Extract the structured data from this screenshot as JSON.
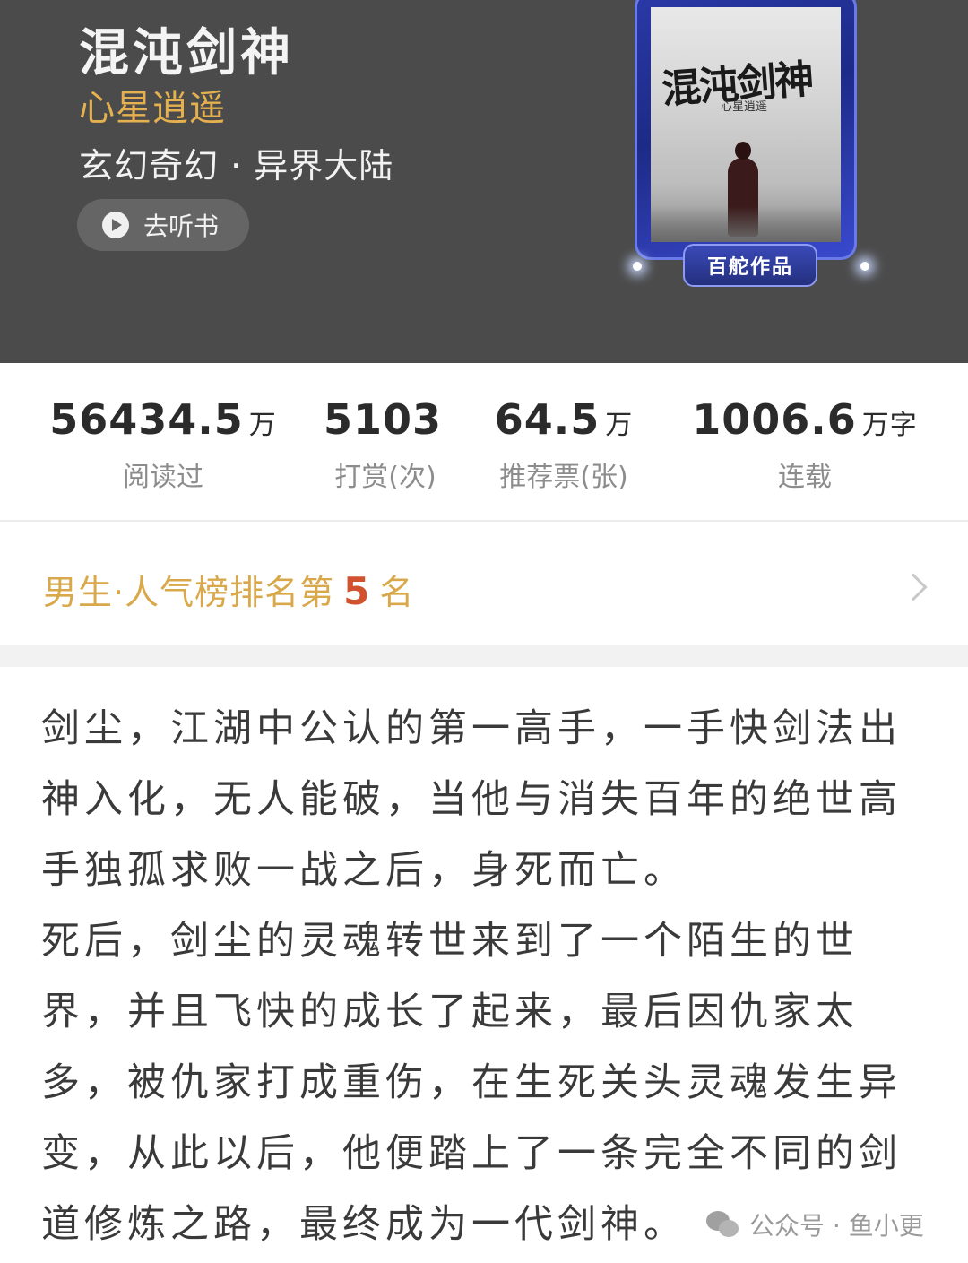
{
  "book": {
    "title": "混沌剑神",
    "author": "心星逍遥",
    "genre": "玄幻奇幻 · 异界大陆",
    "listen_label": "去听书"
  },
  "cover": {
    "title": "混沌剑神",
    "author": "心星逍遥",
    "badge": "百舵作品"
  },
  "stats": [
    {
      "value": "56434.5",
      "unit": "万",
      "caption": "阅读过"
    },
    {
      "value": "5103",
      "unit": "",
      "caption": "打赏(次)"
    },
    {
      "value": "64.5",
      "unit": "万",
      "caption": "推荐票(张)"
    },
    {
      "value": "1006.6",
      "unit": "万字",
      "caption": "连载"
    }
  ],
  "ranking": {
    "prefix": "男生·人气榜排名第",
    "number": "5",
    "suffix": "名"
  },
  "description": [
    "剑尘，江湖中公认的第一高手，一手快剑法出神入化，无人能破，当他与消失百年的绝世高手独孤求败一战之后，身死而亡。",
    "死后，剑尘的灵魂转世来到了一个陌生的世界，并且飞快的成长了起来，最后因仇家太多，被仇家打成重伤，在生死关头灵魂发生异变，从此以后，他便踏上了一条完全不同的剑道修炼之路，最终成为一代剑神。"
  ],
  "watermark": {
    "text": "公众号 · 鱼小更",
    "icon": "wechat-icon"
  },
  "colors": {
    "header_bg": "#4b4b4b",
    "author": "#e5b04f",
    "rank_text": "#d9a84a",
    "rank_number": "#d2522f"
  }
}
